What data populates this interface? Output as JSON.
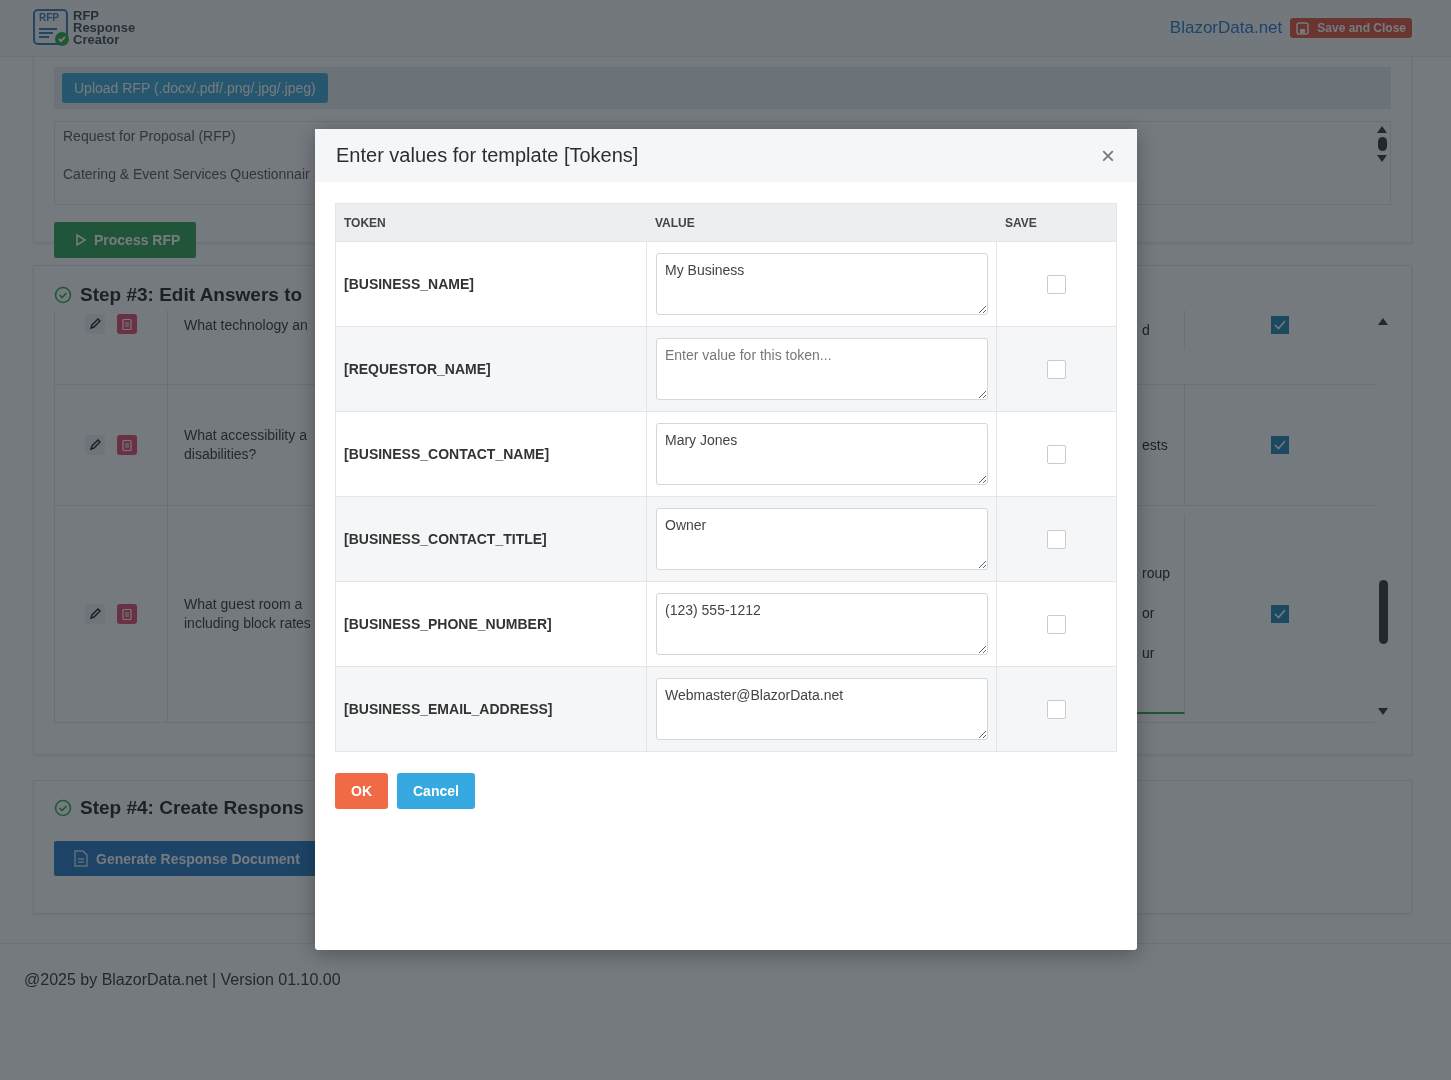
{
  "header": {
    "logo_badge": "RFP",
    "logo_lines": [
      "RFP",
      "Response",
      "Creator"
    ],
    "site_link": "BlazorData.net",
    "save_button": "Save and Close"
  },
  "upload": {
    "button": "Upload RFP (.docx/.pdf/.png/.jpg/.jpeg)",
    "document_lines": [
      "Request for Proposal (RFP)",
      "Catering & Event Services Questionnair"
    ],
    "process_button": "Process RFP"
  },
  "step3": {
    "title": "Step #3: Edit Answers to",
    "rows": [
      {
        "question_lines": [
          "What technology an"
        ],
        "answer_lines": [
          "d"
        ],
        "checked": true
      },
      {
        "question_lines": [
          "What accessibility a",
          "disabilities?"
        ],
        "answer_lines": [
          "ests"
        ],
        "checked": true
      },
      {
        "question_lines": [
          "What guest room a",
          "including block rates"
        ],
        "answer_lines": [
          "roup",
          "or",
          "ur"
        ],
        "checked": true
      }
    ]
  },
  "step4": {
    "title": "Step #4: Create Respons",
    "button": "Generate Response Document"
  },
  "footer": "@2025 by BlazorData.net | Version 01.10.00",
  "modal": {
    "title": "Enter values for template [Tokens]",
    "close": "×",
    "columns": [
      "TOKEN",
      "VALUE",
      "SAVE"
    ],
    "rows": [
      {
        "token": "[BUSINESS_NAME]",
        "value": "My Business",
        "save": false
      },
      {
        "token": "[REQUESTOR_NAME]",
        "placeholder": "Enter value for this token...",
        "save": false
      },
      {
        "token": "[BUSINESS_CONTACT_NAME]",
        "value": "Mary Jones",
        "save": false
      },
      {
        "token": "[BUSINESS_CONTACT_TITLE]",
        "value": "Owner",
        "save": false
      },
      {
        "token": "[BUSINESS_PHONE_NUMBER]",
        "value": "(123) 555-1212",
        "save": false
      },
      {
        "token": "[BUSINESS_EMAIL_ADDRESS]",
        "value": "Webmaster@BlazorData.net",
        "save": false
      }
    ],
    "ok_button": "OK",
    "cancel_button": "Cancel"
  }
}
